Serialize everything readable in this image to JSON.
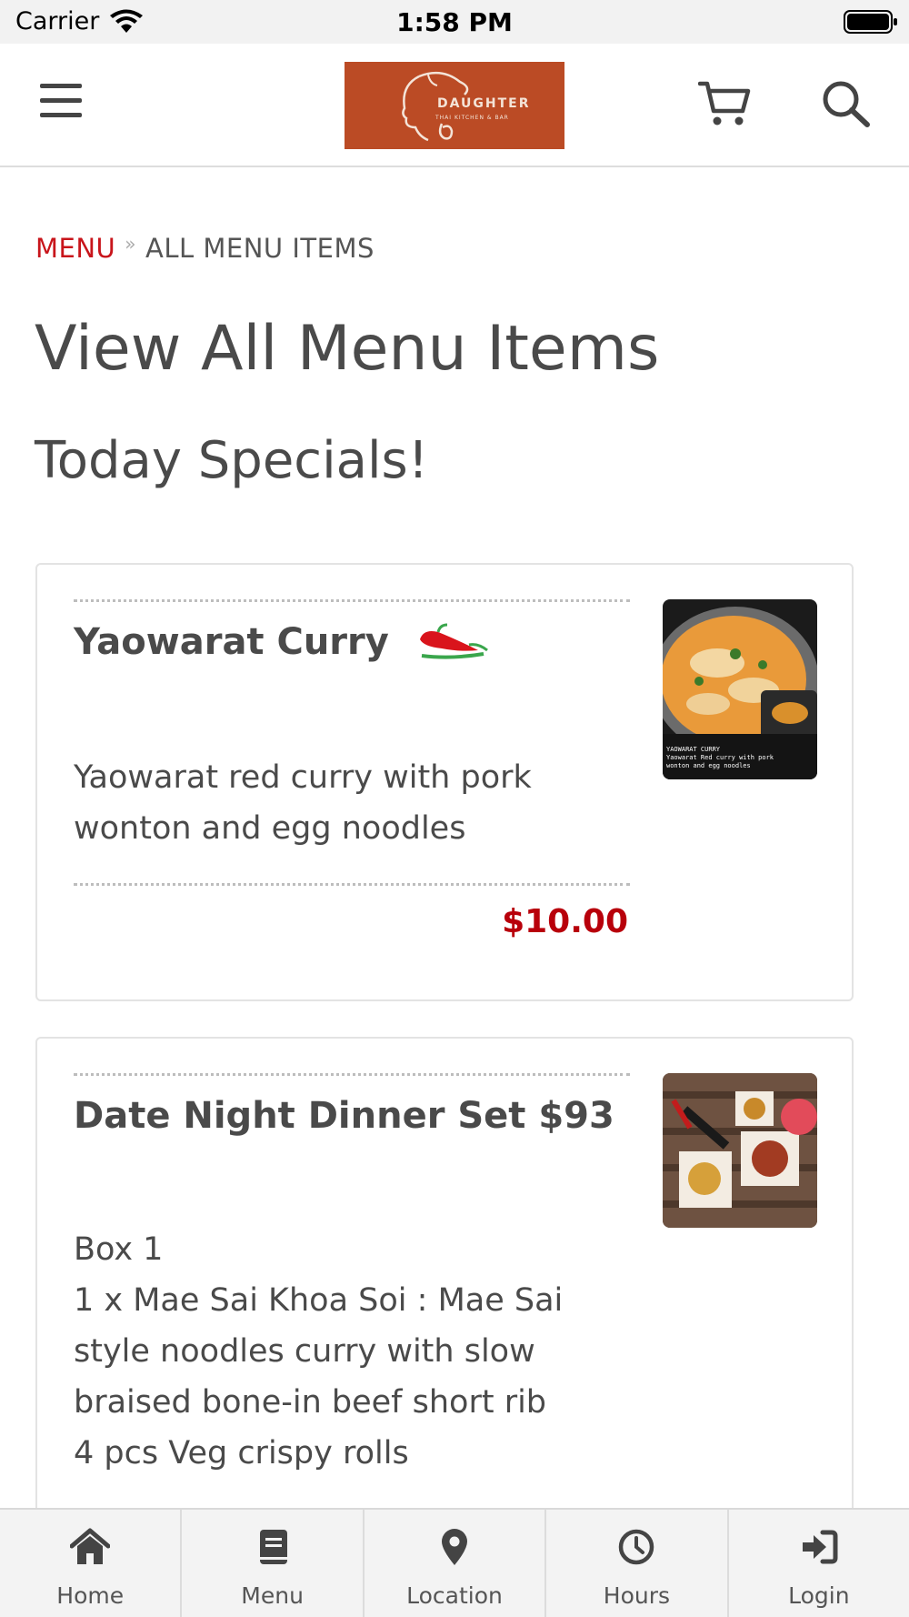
{
  "status_bar": {
    "carrier": "Carrier",
    "time": "1:58 PM"
  },
  "header": {
    "logo": {
      "name": "DAUGHTER",
      "subtitle": "THAI KITCHEN & BAR",
      "background": "#bb4b25"
    },
    "icons": [
      "menu-icon",
      "cart-icon",
      "search-icon"
    ]
  },
  "breadcrumb": {
    "root": "MENU",
    "current": "ALL MENU ITEMS"
  },
  "page_title": "View All Menu Items",
  "section_title": "Today Specials!",
  "items": [
    {
      "name": "Yaowarat Curry",
      "spicy_icon": "chili-pepper-icon",
      "description": "Yaowarat red curry with pork\nwonton and egg noodles",
      "price": "$10.00",
      "image_caption": "YAOWARAT CURRY\nYaowarat Red curry with pork\nwonton and egg noodles"
    },
    {
      "name": "Date Night Dinner Set $93",
      "description": "Box 1\n1 x Mae Sai Khoa Soi : Mae Sai\nstyle noodles curry with slow\nbraised bone-in beef short rib\n4 pcs Veg crispy rolls"
    }
  ],
  "tabs": [
    {
      "label": "Home",
      "icon": "home-icon"
    },
    {
      "label": "Menu",
      "icon": "book-icon"
    },
    {
      "label": "Location",
      "icon": "map-pin-icon"
    },
    {
      "label": "Hours",
      "icon": "clock-icon"
    },
    {
      "label": "Login",
      "icon": "login-icon"
    }
  ],
  "colors": {
    "accent": "#c8151b",
    "price": "#b8000b",
    "text": "#4a4a4a"
  }
}
